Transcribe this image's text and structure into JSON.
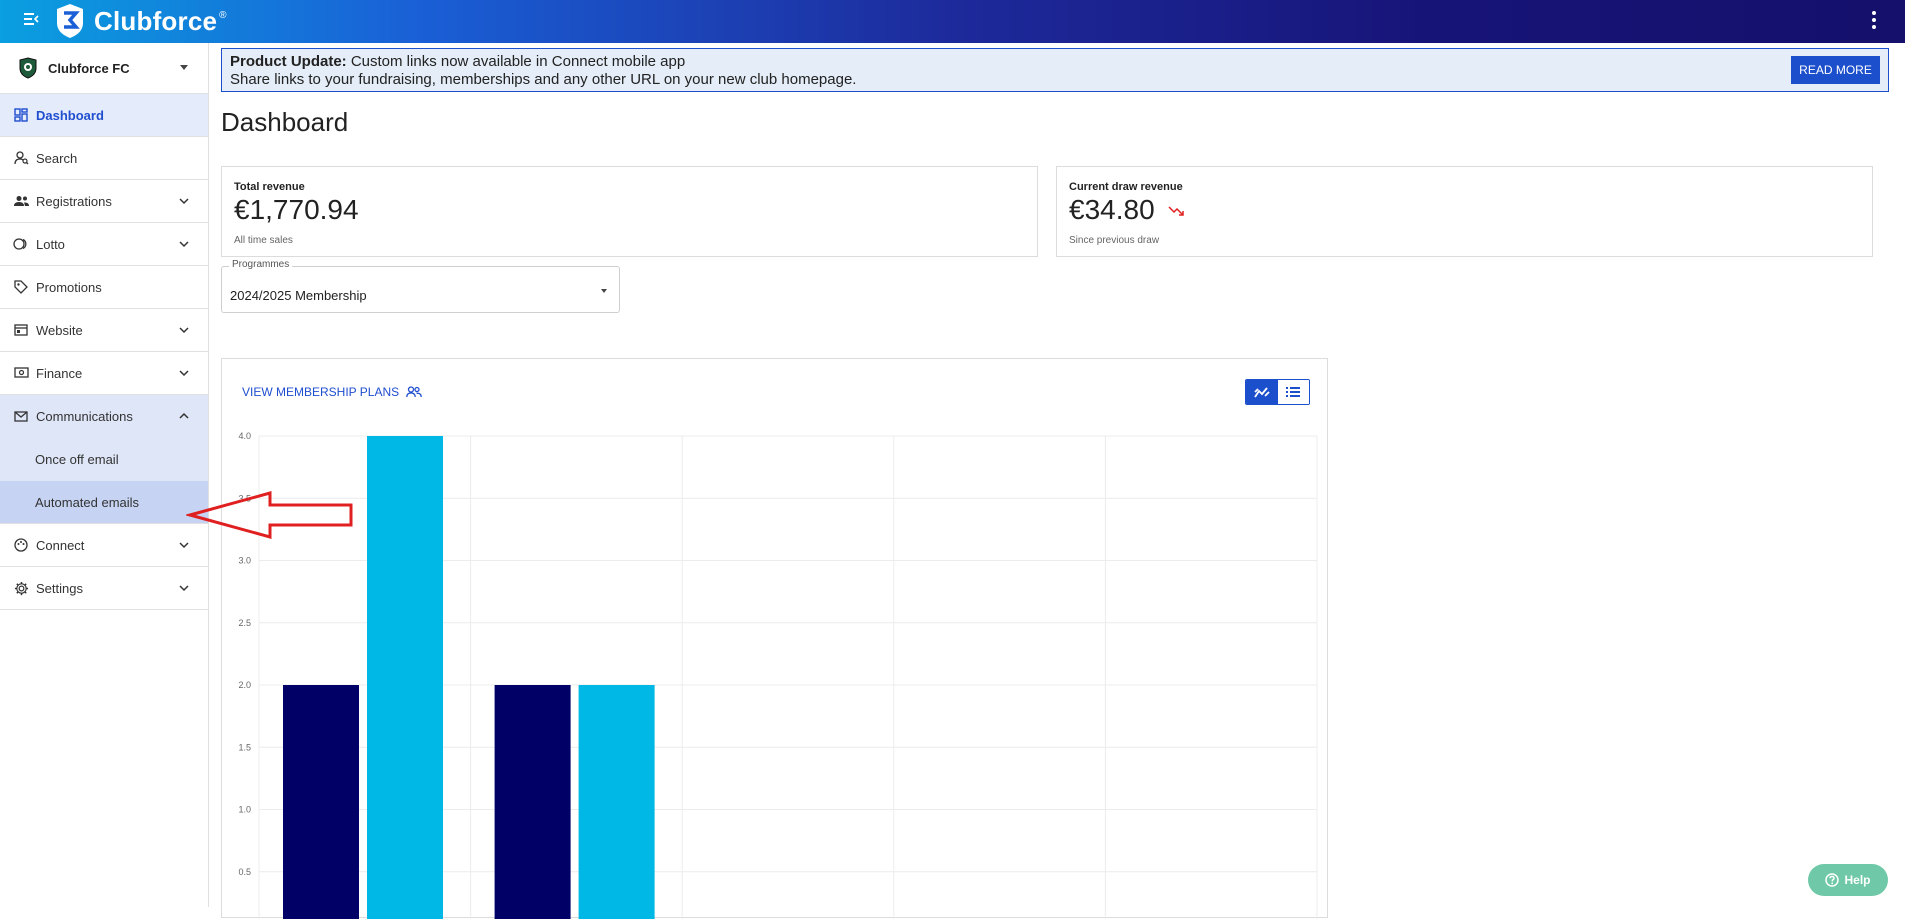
{
  "app": {
    "brand": "Clubforce",
    "reg_mark": "®"
  },
  "colors": {
    "accent": "#1c4fcc",
    "bar_dark": "#000066",
    "bar_light": "#00b8e6",
    "arrow": "#e02020",
    "help": "#6fc9a8"
  },
  "sidebar": {
    "club_name": "Clubforce FC",
    "items": [
      {
        "label": "Dashboard",
        "icon": "dashboard-icon"
      },
      {
        "label": "Search",
        "icon": "person-search-icon"
      },
      {
        "label": "Registrations",
        "icon": "people-icon"
      },
      {
        "label": "Lotto",
        "icon": "lotto-icon"
      },
      {
        "label": "Promotions",
        "icon": "tag-icon"
      },
      {
        "label": "Website",
        "icon": "browser-icon"
      },
      {
        "label": "Finance",
        "icon": "finance-icon"
      },
      {
        "label": "Communications",
        "icon": "mail-icon"
      },
      {
        "label": "Connect",
        "icon": "palette-icon"
      },
      {
        "label": "Settings",
        "icon": "gear-icon"
      }
    ],
    "communications_sub": [
      {
        "label": "Once off email"
      },
      {
        "label": "Automated emails"
      }
    ]
  },
  "banner": {
    "title": "Product Update:",
    "headline": " Custom links now available in Connect mobile app",
    "body": "Share links to your fundraising, memberships and any other URL on your new club homepage.",
    "button": "READ MORE"
  },
  "page": {
    "title": "Dashboard"
  },
  "cards": [
    {
      "label": "Total revenue",
      "value": "€1,770.94",
      "sub": "All time sales"
    },
    {
      "label": "Current draw revenue",
      "value": "€34.80",
      "sub": "Since previous draw",
      "trend": "trending-down-icon"
    }
  ],
  "programmes": {
    "legend": "Programmes",
    "value": "2024/2025 Membership"
  },
  "chart_panel": {
    "view_plans": "VIEW MEMBERSHIP PLANS"
  },
  "chart_data": {
    "type": "bar",
    "ylim": [
      0,
      4.0
    ],
    "yticks": [
      "0.5",
      "1.0",
      "1.5",
      "2.0",
      "2.5",
      "3.0",
      "3.5",
      "4.0"
    ],
    "groups": 5,
    "series": [
      {
        "values": [
          2,
          2,
          null,
          null,
          null
        ],
        "color": "#000066"
      },
      {
        "values": [
          4,
          2,
          null,
          null,
          null
        ],
        "color": "#00b8e6"
      }
    ],
    "grid": true
  },
  "help": {
    "label": "Help"
  }
}
